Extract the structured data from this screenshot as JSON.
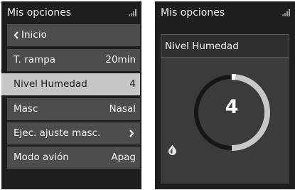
{
  "left_screen": {
    "title": "Mis opciones",
    "signal_icon": "signal-bars-icon",
    "menu": {
      "back_label": "Inicio",
      "ramp_label": "T. rampa",
      "ramp_value": "20min",
      "humidity_label": "Nivel Humedad",
      "humidity_value": "4",
      "mask_label": "Masc",
      "mask_value": "Nasal",
      "mask_fit_label": "Ejec. ajuste masc.",
      "airplane_label": "Modo avión",
      "airplane_value": "Apag"
    }
  },
  "right_screen": {
    "title": "Mis opciones",
    "signal_icon": "signal-bars-icon",
    "panel_title": "Nivel Humedad",
    "gauge": {
      "value": "4",
      "min": 0,
      "max": 8,
      "track_color": "#ffffff",
      "highlight_color": "#c8c8c8"
    },
    "humidity_icon": "water-drop-icon"
  },
  "colors": {
    "screen_bg": "#1e1e1e",
    "item_bg": "#4d4d4d",
    "selected_bg": "#c6c6c6",
    "panel_bg": "#3b3b3b"
  }
}
